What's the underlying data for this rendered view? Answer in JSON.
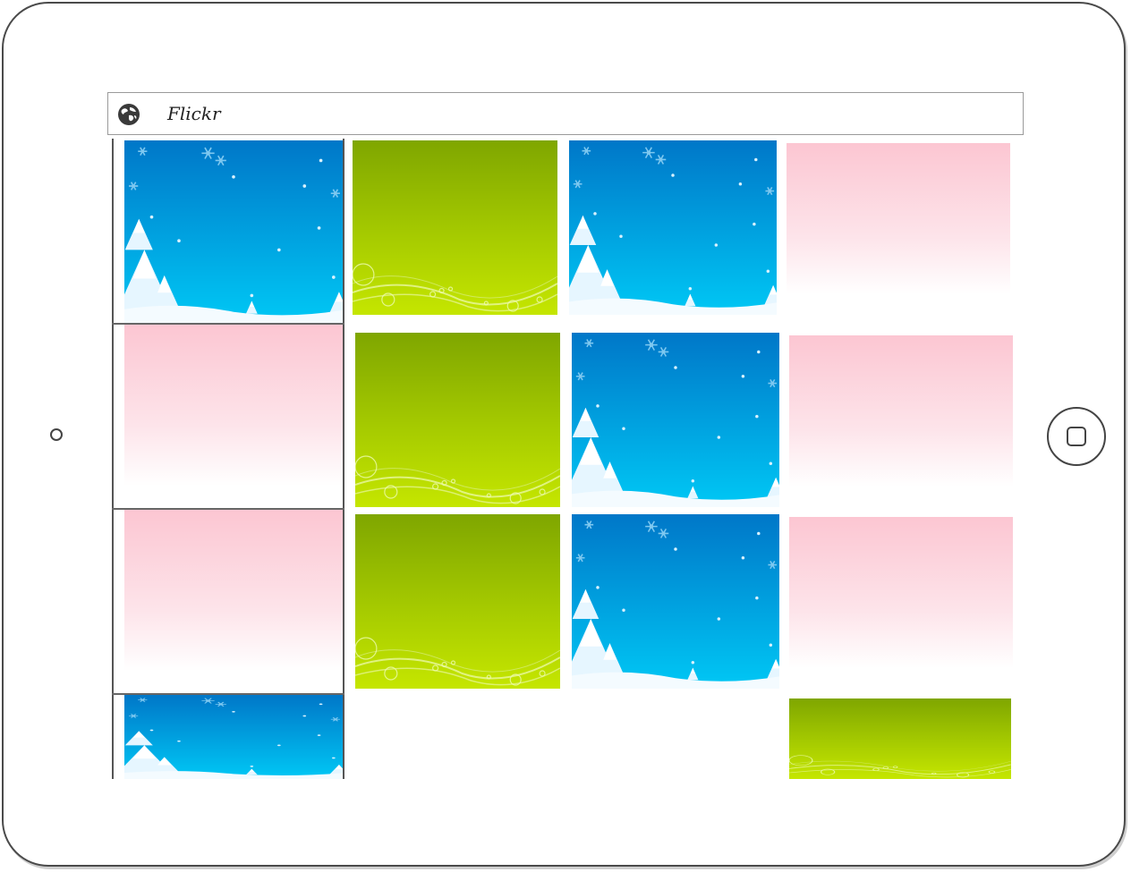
{
  "browser": {
    "site_title": "Flickr",
    "icon": "globe-icon"
  },
  "thumbnails": {
    "left_column": [
      "winter-blue",
      "pink",
      "pink",
      "winter-blue"
    ],
    "column_2": [
      "green",
      "green",
      "green"
    ],
    "column_3": [
      "winter-blue",
      "winter-blue",
      "winter-blue"
    ],
    "column_4": [
      "pink",
      "pink",
      "pink",
      "green"
    ]
  },
  "colors": {
    "winter_top": "#0077c8",
    "winter_bottom": "#00c8f5",
    "pink_top": "#fcc6d2",
    "green_top": "#7fa600",
    "green_bottom": "#c5e600"
  },
  "device": {
    "home_button": "home-button-icon",
    "side_button": "camera-icon"
  }
}
